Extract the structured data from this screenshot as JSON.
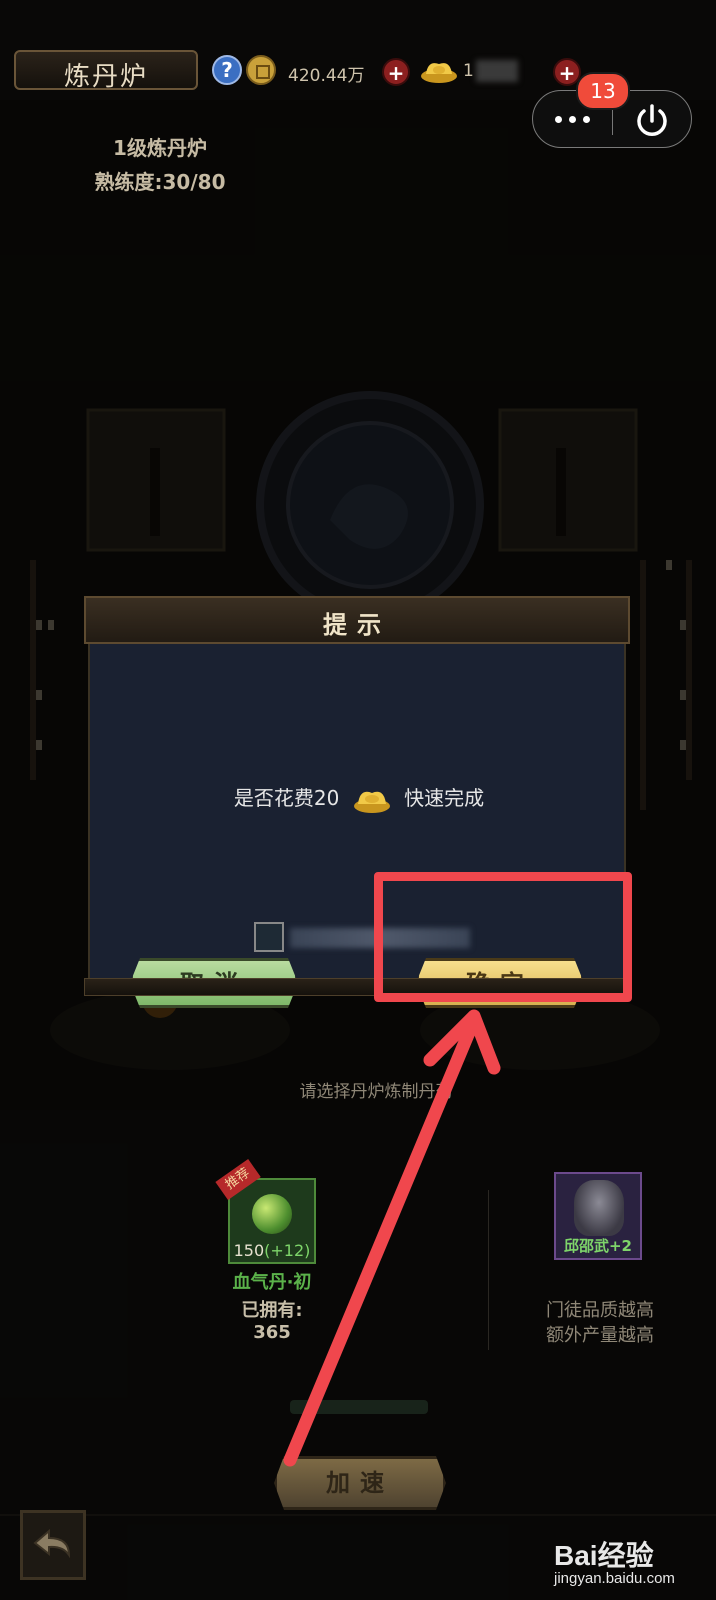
{
  "top_bar": {
    "title": "炼丹炉",
    "help_symbol": "?",
    "coin_amount": "420.44万",
    "plus_symbol": "+",
    "ingot_amount": "1"
  },
  "mini_program": {
    "more_icon": "more-dots-icon",
    "power_icon": "power-icon",
    "badge_count": "13"
  },
  "furnace": {
    "level": "1级炼丹炉",
    "proficiency": "熟练度:30/80"
  },
  "dialog": {
    "title": "提示",
    "prompt_before": "是否花费20",
    "prompt_after": "快速完成",
    "cancel_label": "取消",
    "confirm_label": "确定"
  },
  "lower": {
    "select_prompt": "请选择丹炉炼制丹药",
    "recommend_tag": "推荐",
    "pill_count": "150",
    "pill_bonus": "(+12)",
    "pill_name": "血气丹·初",
    "owned_label": "已拥有:",
    "owned_count": "365",
    "disciple_name": "邱邵武+2",
    "quality_line1": "门徒品质越高",
    "quality_line2": "额外产量越高",
    "speedup_label": "加速"
  },
  "watermark": {
    "brand": "Bai经验",
    "url": "jingyan.baidu.com"
  },
  "colors": {
    "annotation_red": "#f0474d",
    "confirm_gold": "#f7df8d",
    "cancel_green": "#b9dca0",
    "dialog_body": "#1a2131"
  }
}
